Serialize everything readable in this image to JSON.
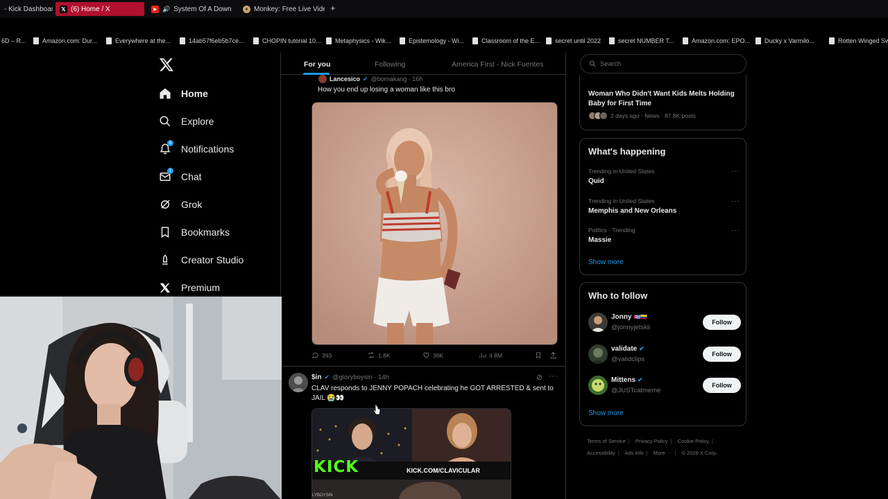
{
  "browser": {
    "tabs": [
      {
        "label": "- Kick Dashboard",
        "active": false
      },
      {
        "label": "(6) Home / X",
        "active": true
      },
      {
        "label": "System Of A Down - ",
        "active": false
      },
      {
        "label": "Monkey: Free Live Video",
        "active": false
      }
    ],
    "new_tab": "+",
    "bookmarks": [
      "6D – R...",
      "Amazon.com: Dur...",
      "Everywhere at the...",
      "14ab57f6eb5b7ce...",
      "CHOPIN tutorial 10...",
      "Metaphysics - Wik...",
      "Epistemology - Wi...",
      "Classroom of the E...",
      "secret until 2022",
      "secret NUMBER T...",
      "Amazon.com: EPO...",
      "Ducky x Varmilo...",
      "Rotten Winged Sw"
    ]
  },
  "nav": {
    "items": [
      {
        "label": "Home",
        "icon": "home-icon"
      },
      {
        "label": "Explore",
        "icon": "search-icon"
      },
      {
        "label": "Notifications",
        "icon": "bell-icon",
        "badge": "6"
      },
      {
        "label": "Chat",
        "icon": "mail-icon",
        "badge": "1"
      },
      {
        "label": "Grok",
        "icon": "grok-icon"
      },
      {
        "label": "Bookmarks",
        "icon": "bookmark-icon"
      },
      {
        "label": "Creator Studio",
        "icon": "creator-studio-icon"
      },
      {
        "label": "Premium",
        "icon": "x-logo-icon"
      }
    ]
  },
  "feed": {
    "tabs": [
      "For you",
      "Following",
      "America First - Nick Fuentes"
    ],
    "tweet1": {
      "name": "Lancesico",
      "handle": "@bornakang · 16h",
      "text": "How you end up losing a woman like this bro",
      "replies": "393",
      "reposts": "1.8K",
      "likes": "36K",
      "views": "4.8M"
    },
    "tweet2": {
      "name": "$in",
      "handle": "@gloryboysin · 14h",
      "text_line1": "CLAV responds to JENNY POPACH celebrating he GOT ARRESTED & sent to",
      "text_line2": "JAIL 😭👀",
      "media_kick": "KICK",
      "media_url": "KICK.COM/CLAVICULAR",
      "media_watermark": "LYBOYSIN"
    }
  },
  "sidebar": {
    "search_placeholder": "Search",
    "news": {
      "title": "Woman Who Didn't Want Kids Melts Holding Baby for First Time",
      "meta": "2 days ago · News · 87.8K posts"
    },
    "happening": {
      "title": "What's happening",
      "trends": [
        {
          "context": "Trending in United States",
          "name": "Quid"
        },
        {
          "context": "Trending in United States",
          "name": "Memphis and New Orleans"
        },
        {
          "context": "Politics · Trending",
          "name": "Massie"
        }
      ],
      "show_more": "Show more"
    },
    "who_to_follow": {
      "title": "Who to follow",
      "users": [
        {
          "name": "Jonny",
          "handle": "@jonnyjetskii",
          "button": "Follow"
        },
        {
          "name": "validate",
          "handle": "@validclips",
          "button": "Follow"
        },
        {
          "name": "Mittens",
          "handle": "@JUSTcatmeme",
          "button": "Follow"
        }
      ],
      "show_more": "Show more"
    },
    "footer": [
      "Terms of Service",
      "Privacy Policy",
      "Cookie Policy",
      "Accessibility",
      "Ads info",
      "More ···",
      "© 2026 X Corp."
    ]
  },
  "colors": {
    "accent": "#1d9bf0",
    "active_tab": "#b1102e",
    "border": "#2f3336",
    "muted_text": "#71767b",
    "kick_green": "#53fc18"
  }
}
